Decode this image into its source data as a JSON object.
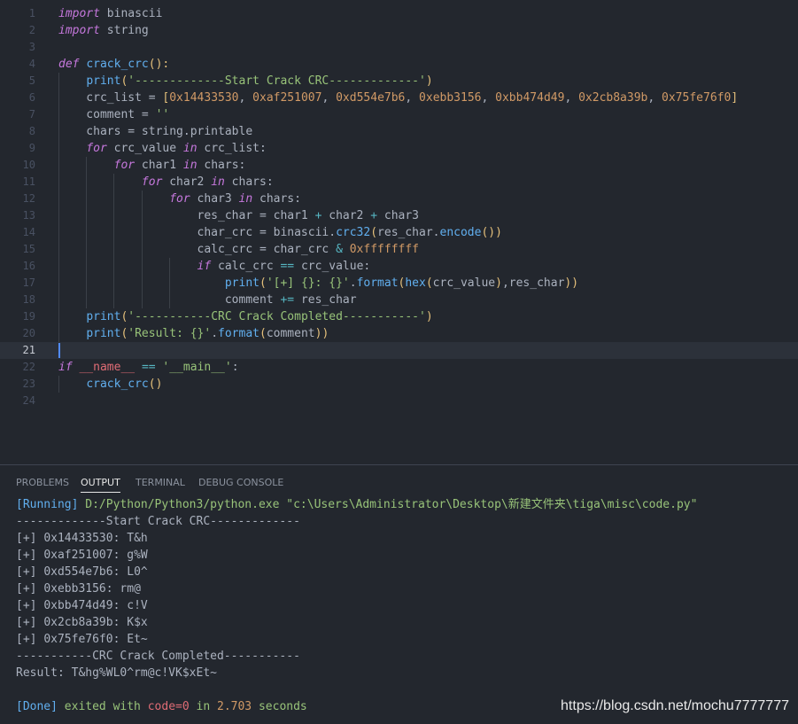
{
  "editor": {
    "lines": [
      {
        "n": "1",
        "t": [
          {
            "c": "kw",
            "s": "import"
          },
          {
            "c": "plain",
            "s": " binascii"
          }
        ]
      },
      {
        "n": "2",
        "t": [
          {
            "c": "kw",
            "s": "import"
          },
          {
            "c": "plain",
            "s": " string"
          }
        ]
      },
      {
        "n": "3",
        "t": []
      },
      {
        "n": "4",
        "t": [
          {
            "c": "kw",
            "s": "def "
          },
          {
            "c": "fn",
            "s": "crack_crc"
          },
          {
            "c": "br",
            "s": "():"
          }
        ]
      },
      {
        "n": "5",
        "t": [
          {
            "c": "plain",
            "s": "    "
          },
          {
            "c": "fn",
            "s": "print"
          },
          {
            "c": "br",
            "s": "("
          },
          {
            "c": "str",
            "s": "'-------------Start Crack CRC-------------'"
          },
          {
            "c": "br",
            "s": ")"
          }
        ]
      },
      {
        "n": "6",
        "t": [
          {
            "c": "plain",
            "s": "    crc_list = "
          },
          {
            "c": "br",
            "s": "["
          },
          {
            "c": "num",
            "s": "0x14433530"
          },
          {
            "c": "plain",
            "s": ", "
          },
          {
            "c": "num",
            "s": "0xaf251007"
          },
          {
            "c": "plain",
            "s": ", "
          },
          {
            "c": "num",
            "s": "0xd554e7b6"
          },
          {
            "c": "plain",
            "s": ", "
          },
          {
            "c": "num",
            "s": "0xebb3156"
          },
          {
            "c": "plain",
            "s": ", "
          },
          {
            "c": "num",
            "s": "0xbb474d49"
          },
          {
            "c": "plain",
            "s": ", "
          },
          {
            "c": "num",
            "s": "0x2cb8a39b"
          },
          {
            "c": "plain",
            "s": ", "
          },
          {
            "c": "num",
            "s": "0x75fe76f0"
          },
          {
            "c": "br",
            "s": "]"
          }
        ]
      },
      {
        "n": "7",
        "t": [
          {
            "c": "plain",
            "s": "    comment = "
          },
          {
            "c": "str",
            "s": "''"
          }
        ]
      },
      {
        "n": "8",
        "t": [
          {
            "c": "plain",
            "s": "    chars = string.printable"
          }
        ]
      },
      {
        "n": "9",
        "t": [
          {
            "c": "plain",
            "s": "    "
          },
          {
            "c": "kw",
            "s": "for"
          },
          {
            "c": "plain",
            "s": " crc_value "
          },
          {
            "c": "kw",
            "s": "in"
          },
          {
            "c": "plain",
            "s": " crc_list:"
          }
        ]
      },
      {
        "n": "10",
        "t": [
          {
            "c": "plain",
            "s": "        "
          },
          {
            "c": "kw",
            "s": "for"
          },
          {
            "c": "plain",
            "s": " char1 "
          },
          {
            "c": "kw",
            "s": "in"
          },
          {
            "c": "plain",
            "s": " chars:"
          }
        ]
      },
      {
        "n": "11",
        "t": [
          {
            "c": "plain",
            "s": "            "
          },
          {
            "c": "kw",
            "s": "for"
          },
          {
            "c": "plain",
            "s": " char2 "
          },
          {
            "c": "kw",
            "s": "in"
          },
          {
            "c": "plain",
            "s": " chars:"
          }
        ]
      },
      {
        "n": "12",
        "t": [
          {
            "c": "plain",
            "s": "                "
          },
          {
            "c": "kw",
            "s": "for"
          },
          {
            "c": "plain",
            "s": " char3 "
          },
          {
            "c": "kw",
            "s": "in"
          },
          {
            "c": "plain",
            "s": " chars:"
          }
        ]
      },
      {
        "n": "13",
        "t": [
          {
            "c": "plain",
            "s": "                    res_char = char1 "
          },
          {
            "c": "op",
            "s": "+"
          },
          {
            "c": "plain",
            "s": " char2 "
          },
          {
            "c": "op",
            "s": "+"
          },
          {
            "c": "plain",
            "s": " char3"
          }
        ]
      },
      {
        "n": "14",
        "t": [
          {
            "c": "plain",
            "s": "                    char_crc = binascii."
          },
          {
            "c": "fn",
            "s": "crc32"
          },
          {
            "c": "br",
            "s": "("
          },
          {
            "c": "plain",
            "s": "res_char."
          },
          {
            "c": "fn",
            "s": "encode"
          },
          {
            "c": "br",
            "s": "())"
          }
        ]
      },
      {
        "n": "15",
        "t": [
          {
            "c": "plain",
            "s": "                    calc_crc = char_crc "
          },
          {
            "c": "op",
            "s": "&"
          },
          {
            "c": "plain",
            "s": " "
          },
          {
            "c": "num",
            "s": "0xffffffff"
          }
        ]
      },
      {
        "n": "16",
        "t": [
          {
            "c": "plain",
            "s": "                    "
          },
          {
            "c": "kw",
            "s": "if"
          },
          {
            "c": "plain",
            "s": " calc_crc "
          },
          {
            "c": "op",
            "s": "=="
          },
          {
            "c": "plain",
            "s": " crc_value:"
          }
        ]
      },
      {
        "n": "17",
        "t": [
          {
            "c": "plain",
            "s": "                        "
          },
          {
            "c": "fn",
            "s": "print"
          },
          {
            "c": "br",
            "s": "("
          },
          {
            "c": "str",
            "s": "'[+] {}: {}'"
          },
          {
            "c": "plain",
            "s": "."
          },
          {
            "c": "fn",
            "s": "format"
          },
          {
            "c": "br",
            "s": "("
          },
          {
            "c": "fn",
            "s": "hex"
          },
          {
            "c": "br",
            "s": "("
          },
          {
            "c": "plain",
            "s": "crc_value"
          },
          {
            "c": "br",
            "s": ")"
          },
          {
            "c": "plain",
            "s": ",res_char"
          },
          {
            "c": "br",
            "s": "))"
          }
        ]
      },
      {
        "n": "18",
        "t": [
          {
            "c": "plain",
            "s": "                        comment "
          },
          {
            "c": "op",
            "s": "+="
          },
          {
            "c": "plain",
            "s": " res_char"
          }
        ]
      },
      {
        "n": "19",
        "t": [
          {
            "c": "plain",
            "s": "    "
          },
          {
            "c": "fn",
            "s": "print"
          },
          {
            "c": "br",
            "s": "("
          },
          {
            "c": "str",
            "s": "'-----------CRC Crack Completed-----------'"
          },
          {
            "c": "br",
            "s": ")"
          }
        ]
      },
      {
        "n": "20",
        "t": [
          {
            "c": "plain",
            "s": "    "
          },
          {
            "c": "fn",
            "s": "print"
          },
          {
            "c": "br",
            "s": "("
          },
          {
            "c": "str",
            "s": "'Result: {}'"
          },
          {
            "c": "plain",
            "s": "."
          },
          {
            "c": "fn",
            "s": "format"
          },
          {
            "c": "br",
            "s": "("
          },
          {
            "c": "plain",
            "s": "comment"
          },
          {
            "c": "br",
            "s": "))"
          }
        ]
      },
      {
        "n": "21",
        "t": [],
        "current": true
      },
      {
        "n": "22",
        "t": [
          {
            "c": "kw",
            "s": "if"
          },
          {
            "c": "plain",
            "s": " "
          },
          {
            "c": "name",
            "s": "__name__"
          },
          {
            "c": "plain",
            "s": " "
          },
          {
            "c": "op",
            "s": "=="
          },
          {
            "c": "plain",
            "s": " "
          },
          {
            "c": "str",
            "s": "'__main__'"
          },
          {
            "c": "plain",
            "s": ":"
          }
        ]
      },
      {
        "n": "23",
        "t": [
          {
            "c": "plain",
            "s": "    "
          },
          {
            "c": "fn",
            "s": "crack_crc"
          },
          {
            "c": "br",
            "s": "()"
          }
        ]
      },
      {
        "n": "24",
        "t": []
      }
    ]
  },
  "panel": {
    "tabs": [
      {
        "label": "PROBLEMS",
        "active": false
      },
      {
        "label": "OUTPUT",
        "active": true
      },
      {
        "label": "TERMINAL",
        "active": false
      },
      {
        "label": "DEBUG CONSOLE",
        "active": false
      }
    ],
    "running_tag": "[Running]",
    "running_cmd": "D:/Python/Python3/python.exe",
    "running_path": "\"c:\\Users\\Administrator\\Desktop\\新建文件夹\\tiga\\misc\\code.py\"",
    "start_line": "-------------Start Crack CRC-------------",
    "results": [
      {
        "prefix": "[+] ",
        "hex": "0x14433530",
        "sep": ": ",
        "val": "T&h"
      },
      {
        "prefix": "[+] ",
        "hex": "0xaf251007",
        "sep": ": ",
        "val": "g%W"
      },
      {
        "prefix": "[+] ",
        "hex": "0xd554e7b6",
        "sep": ": ",
        "val": "L0^"
      },
      {
        "prefix": "[+] ",
        "hex": "0xebb3156",
        "sep": ": ",
        "val": "rm@"
      },
      {
        "prefix": "[+] ",
        "hex": "0xbb474d49",
        "sep": ": ",
        "val": "c!V"
      },
      {
        "prefix": "[+] ",
        "hex": "0x2cb8a39b",
        "sep": ": ",
        "val": "K$x"
      },
      {
        "prefix": "[+] ",
        "hex": "0x75fe76f0",
        "sep": ": ",
        "val": "Et~"
      }
    ],
    "completed_line": "-----------CRC Crack Completed-----------",
    "result_line": "Result: T&hg%WL0^rm@c!VK$xEt~",
    "done_tag": "[Done]",
    "done_text": " exited with ",
    "done_code": "code=0",
    "done_in": " in ",
    "done_secs": "2.703",
    "done_unit": " seconds"
  },
  "watermark": "https://blog.csdn.net/mochu7777777"
}
